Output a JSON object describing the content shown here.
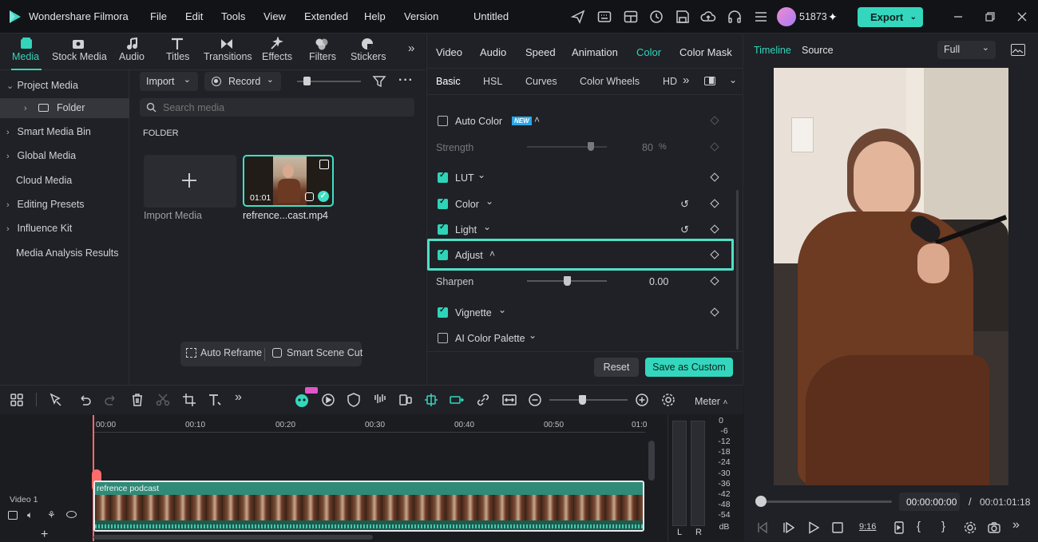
{
  "app": {
    "name": "Wondershare Filmora",
    "project_title": "Untitled",
    "user_id": "51873"
  },
  "menu": [
    "File",
    "Edit",
    "Tools",
    "View",
    "Extended",
    "Help",
    "Version"
  ],
  "export_label": "Export",
  "media_tabs": [
    {
      "label": "Media",
      "icon": "media-icon",
      "active": true
    },
    {
      "label": "Stock Media",
      "icon": "stock-media-icon"
    },
    {
      "label": "Audio",
      "icon": "audio-icon"
    },
    {
      "label": "Titles",
      "icon": "titles-icon"
    },
    {
      "label": "Transitions",
      "icon": "transitions-icon"
    },
    {
      "label": "Effects",
      "icon": "effects-icon"
    },
    {
      "label": "Filters",
      "icon": "filters-icon"
    },
    {
      "label": "Stickers",
      "icon": "stickers-icon"
    }
  ],
  "sidebar": {
    "items": [
      "Project Media",
      "Folder",
      "Smart Media Bin",
      "Global Media",
      "Cloud Media",
      "Editing Presets",
      "Influence Kit",
      "Media Analysis Results"
    ]
  },
  "media": {
    "import_label": "Import",
    "record_label": "Record",
    "search_placeholder": "Search media",
    "folder_heading": "FOLDER",
    "import_tile_label": "Import Media",
    "clip_name": "refrence...cast.mp4",
    "clip_duration": "01:01",
    "auto_reframe": "Auto Reframe",
    "smart_scene_cut": "Smart Scene Cut"
  },
  "props": {
    "tabs": [
      "Video",
      "Audio",
      "Speed",
      "Animation",
      "Color",
      "Color Mask"
    ],
    "active_tab": "Color",
    "subtabs": [
      "Basic",
      "HSL",
      "Curves",
      "Color Wheels",
      "HD"
    ],
    "auto_color": "Auto Color",
    "new_badge": "NEW",
    "strength_label": "Strength",
    "strength_value": "80",
    "strength_unit": "%",
    "strength_level": 0.8,
    "lut": "LUT",
    "color": "Color",
    "light": "Light",
    "adjust": "Adjust",
    "sharpen_label": "Sharpen",
    "sharpen_value": "0.00",
    "vignette": "Vignette",
    "ai_palette": "AI Color Palette",
    "reset": "Reset",
    "save_custom": "Save as Custom"
  },
  "preview": {
    "tabs": [
      "Timeline",
      "Source"
    ],
    "quality": "Full",
    "current_time": "00:00:00:00",
    "separator": "/",
    "total_time": "00:01:01:18",
    "aspect": "9:16"
  },
  "timeline": {
    "ruler": [
      "00:00",
      "00:10",
      "00:20",
      "00:30",
      "00:40",
      "00:50",
      "01:0"
    ],
    "track_name": "Video 1",
    "clip_label": "refrence podcast",
    "meter_label": "Meter",
    "meter_scale": [
      "0",
      "-6",
      "-12",
      "-18",
      "-24",
      "-30",
      "-36",
      "-42",
      "-48",
      "-54",
      "dB"
    ],
    "meter_l": "L",
    "meter_r": "R"
  },
  "colors": {
    "accent": "#2fd3b8",
    "bg": "#1b1d21",
    "panel": "#1f2126"
  }
}
